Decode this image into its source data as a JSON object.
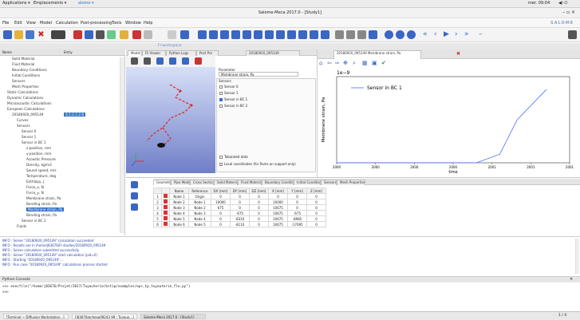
{
  "gnome": {
    "applications": "Applications ▾",
    "emplacements": "Emplacements ▾",
    "app_menu": "alome ▾",
    "clock": "mer. 09:04"
  },
  "window": {
    "title": "Salome-Meca 2017.0 - [Study1]"
  },
  "menu": [
    "File",
    "Edit",
    "View",
    "Model",
    "Calculation",
    "Post-processing",
    "Tools",
    "Window",
    "Help"
  ],
  "brand": "SALOME",
  "workspace_label": "Fl workspace",
  "tree": {
    "columns": [
      "Name",
      "Entry"
    ],
    "items": [
      {
        "label": "Solid Material",
        "indent": 2
      },
      {
        "label": "Fluid Material",
        "indent": 2
      },
      {
        "label": "Boundary Conditions",
        "indent": 2
      },
      {
        "label": "Initial Conditions",
        "indent": 2
      },
      {
        "label": "Sensors",
        "indent": 2
      },
      {
        "label": "Mesh Properties",
        "indent": 2
      },
      {
        "label": "Static Calculations",
        "indent": 1
      },
      {
        "label": "Dynamic Calculations",
        "indent": 1
      },
      {
        "label": "Microacoustic Calculations",
        "indent": 1
      },
      {
        "label": "Europeen Calculations",
        "indent": 1
      },
      {
        "label": "20180920_095149",
        "indent": 2,
        "entry": "0:1:2:1:2:8"
      },
      {
        "label": "Curves",
        "indent": 3
      },
      {
        "label": "Sensors",
        "indent": 3
      },
      {
        "label": "Sensor 0",
        "indent": 4
      },
      {
        "label": "Sensor 1",
        "indent": 4
      },
      {
        "label": "Sensor in BC 1",
        "indent": 4
      },
      {
        "label": "z-position, mm",
        "indent": 5
      },
      {
        "label": "y-position, mm",
        "indent": 5
      },
      {
        "label": "Acoustic Pressure",
        "indent": 5
      },
      {
        "label": "Density, kg/m3",
        "indent": 5
      },
      {
        "label": "Sound speed, m/s",
        "indent": 5
      },
      {
        "label": "Temperature, deg",
        "indent": 5
      },
      {
        "label": "Enthalpy, J",
        "indent": 5
      },
      {
        "label": "Force_x, N",
        "indent": 5
      },
      {
        "label": "Force_y, N",
        "indent": 5
      },
      {
        "label": "Membrane strain, Pa",
        "indent": 5
      },
      {
        "label": "Bending strain, Pa",
        "indent": 5
      },
      {
        "label": "Membrane strain, Pa",
        "indent": 5,
        "selected": true
      },
      {
        "label": "Bending strain, Pa",
        "indent": 5
      },
      {
        "label": "Sensor in BC 2",
        "indent": 4
      },
      {
        "label": "Fluids",
        "indent": 3
      }
    ]
  },
  "view_tabs": [
    "Model",
    "Fil Viewer",
    "Python Logs",
    "Post Pro"
  ],
  "plot_tabs": [
    "20180920_095149",
    "20180920_095149 Membrane strain, Pa"
  ],
  "parameter": {
    "label": "Parameter",
    "value": "Membrane strain, Pa"
  },
  "sensors_box": {
    "label": "Sensors",
    "items": [
      {
        "label": "Sensor 0",
        "checked": false
      },
      {
        "label": "Sensor 1",
        "checked": false
      },
      {
        "label": "Sensor in BC 1",
        "checked": true
      },
      {
        "label": "Sensor in BC 2",
        "checked": false
      }
    ],
    "tabulated": "Tabulated data",
    "local_coords": "Local coordinates (for Pums on support only)"
  },
  "chart_data": {
    "type": "line",
    "scale_label": "1e−9",
    "ylabel": "Membrane strain, Pa",
    "xlabel": "time",
    "xlim": [
      2000,
      2002
    ],
    "ylim": [
      0,
      100
    ],
    "x_ticks": [
      "2000",
      "2000",
      "2000",
      "2000",
      "2001",
      "2001",
      "2001"
    ],
    "series": [
      {
        "name": "Sensor in BC 1",
        "color": "#4a6cff",
        "x": [
          2000.0,
          2000.4,
          2000.8,
          2001.2,
          2001.4,
          2001.55,
          2001.8
        ],
        "y": [
          0,
          0,
          0,
          0,
          10,
          50,
          85
        ]
      }
    ]
  },
  "bottom_tabs": [
    "Geometry",
    "Pipe Mode",
    "Cross Section",
    "Solid Material",
    "Fluid Material",
    "Boundary Conditions",
    "Initial Conditions",
    "Sensors",
    "Mesh Properties"
  ],
  "table": {
    "headers": [
      "",
      "",
      "Name",
      "Reference",
      "DX [mm]",
      "DY [mm]",
      "DZ [mm]",
      "X [mm]",
      "Y [mm]",
      "Z [mm]"
    ],
    "rows": [
      [
        "1",
        "",
        "Node 1",
        "Origin",
        "0",
        "0",
        "0",
        "0",
        "0",
        "0"
      ],
      [
        "2",
        "",
        "Node 2",
        "Node 1",
        "10000",
        "0",
        "0",
        "10000",
        "0",
        "0"
      ],
      [
        "3",
        "",
        "Node 3",
        "Node 2",
        "675",
        "0",
        "0",
        "10675",
        "0",
        "0"
      ],
      [
        "4",
        "",
        "Node 4",
        "Node 3",
        "0",
        "-675",
        "0",
        "10675",
        "-675",
        "0"
      ],
      [
        "5",
        "",
        "Node 5",
        "Node 4",
        "0",
        "-8310",
        "0",
        "10675",
        "-8985",
        "0"
      ],
      [
        "6",
        "",
        "Node 6",
        "Node 5",
        "0",
        "-8110",
        "0",
        "10675",
        "-17095",
        "0"
      ]
    ]
  },
  "log": [
    "INFO : Solver \"20180920_095149\" calculation succeeded",
    "INFO : Results are in /home/j83676/Fl-studies/20180920_095149",
    "INFO : Solver calculation submitted successfully",
    "INFO : Solver \"20180920_095149\" start calculation [pid=0]",
    "INFO : Starting \"20180920_095149\"...",
    "INFO : Run case \"20180920_095149\" calculations process started"
  ],
  "console": {
    "title": "Python Console",
    "lines": [
      ">>> execfile(\"/home/j83676/Projet/2017/Tuyauterie/bitip/examples/ep×_tp_tuyauterie_flo.py\")",
      ">>>"
    ]
  },
  "taskbar": [
    "[Terminal ~ Diffusion Workstation...]",
    "[j83676@chesp09243 99 : Tuyaux...]",
    "Salome-Meca 2017.0 - [Study1]"
  ],
  "taskbar_pager": "1 / 4"
}
